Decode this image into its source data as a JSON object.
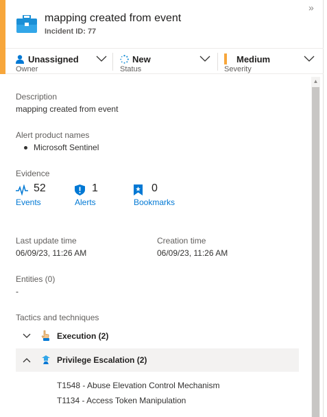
{
  "incident": {
    "title": "mapping created from event",
    "id_label": "Incident ID: 77"
  },
  "meta": {
    "owner": {
      "value": "Unassigned",
      "label": "Owner"
    },
    "status": {
      "value": "New",
      "label": "Status"
    },
    "severity": {
      "value": "Medium",
      "label": "Severity"
    }
  },
  "description": {
    "label": "Description",
    "text": "mapping created from event"
  },
  "alert_products": {
    "label": "Alert product names",
    "items": [
      "Microsoft Sentinel"
    ]
  },
  "evidence": {
    "label": "Evidence",
    "events": {
      "count": "52",
      "label": "Events"
    },
    "alerts": {
      "count": "1",
      "label": "Alerts"
    },
    "bookmarks": {
      "count": "0",
      "label": "Bookmarks"
    }
  },
  "times": {
    "last_update": {
      "label": "Last update time",
      "value": "06/09/23, 11:26 AM"
    },
    "creation": {
      "label": "Creation time",
      "value": "06/09/23, 11:26 AM"
    }
  },
  "entities": {
    "label": "Entities (0)",
    "value": "-"
  },
  "tactics": {
    "label": "Tactics and techniques",
    "items": [
      {
        "name": "Execution (2)",
        "expanded": false
      },
      {
        "name": "Privilege Escalation (2)",
        "expanded": true,
        "techniques": [
          "T1548 - Abuse Elevation Control Mechanism",
          "T1134 - Access Token Manipulation"
        ]
      }
    ]
  },
  "colors": {
    "accent": "#f7a63b",
    "link": "#0078d4",
    "severity_medium": "#f7a63b"
  },
  "icons": {
    "incident": "briefcase-icon",
    "owner": "person-icon",
    "status": "spinner-icon",
    "events": "pulse-icon",
    "alerts": "shield-icon",
    "bookmarks": "bookmark-icon",
    "collapse": "double-chevron-right-icon"
  }
}
